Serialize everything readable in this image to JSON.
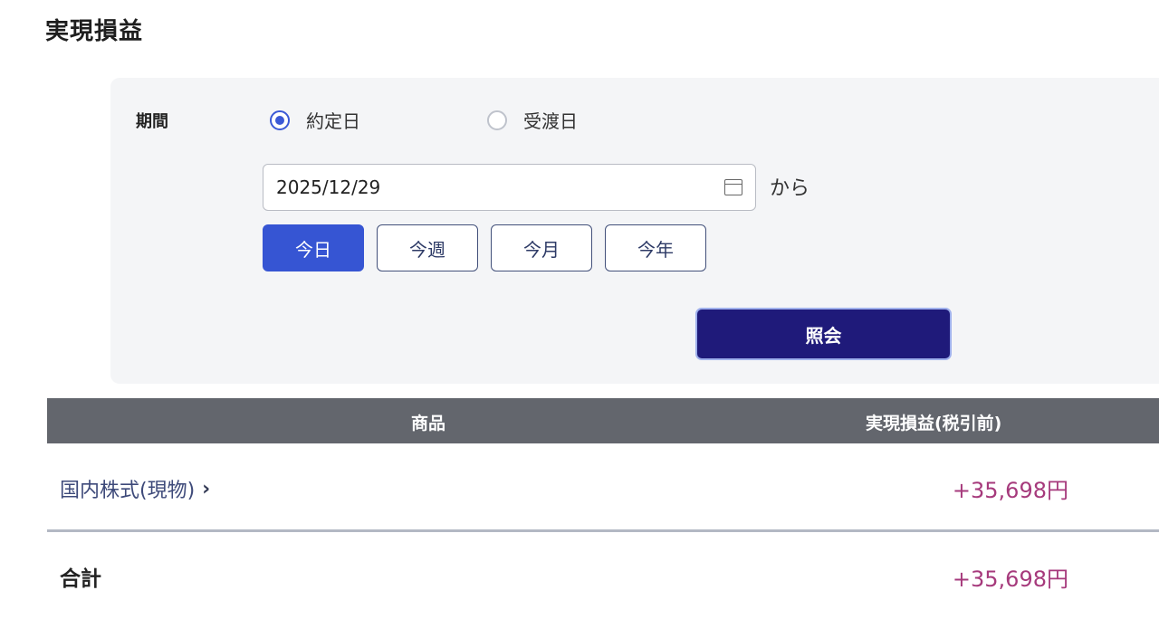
{
  "page": {
    "title": "実現損益"
  },
  "filter": {
    "period_label": "期間",
    "radio_options": [
      {
        "label": "約定日",
        "checked": true
      },
      {
        "label": "受渡日",
        "checked": false
      }
    ],
    "date_value": "2025/12/29",
    "date_suffix": "から",
    "quick_buttons": [
      {
        "label": "今日",
        "active": true
      },
      {
        "label": "今週",
        "active": false
      },
      {
        "label": "今月",
        "active": false
      },
      {
        "label": "今年",
        "active": false
      }
    ],
    "submit_label": "照会"
  },
  "table": {
    "headers": {
      "product": "商品",
      "realized_pl": "実現損益(税引前)"
    },
    "rows": [
      {
        "product": "国内株式(現物)",
        "value": "+35,698円"
      }
    ],
    "total": {
      "label": "合計",
      "value": "+35,698円"
    }
  },
  "colors": {
    "primary": "#3655d3",
    "submit": "#1f1a7a",
    "header_bg": "#63666d",
    "positive_value": "#a63a7c"
  },
  "icons": {
    "calendar": "calendar-icon",
    "chevron": "chevron-right-icon"
  }
}
